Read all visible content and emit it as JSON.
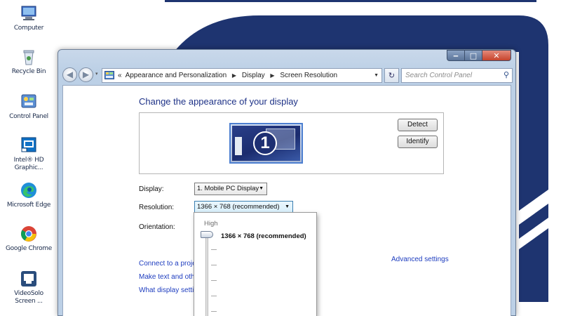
{
  "desktop": {
    "icons": [
      {
        "label": "Computer",
        "icon": "computer-icon"
      },
      {
        "label": "Recycle Bin",
        "icon": "recycle-bin-icon"
      },
      {
        "label": "Control Panel",
        "icon": "control-panel-icon"
      },
      {
        "label": "Intel® HD Graphic...",
        "icon": "intel-graphics-icon"
      },
      {
        "label": "Microsoft Edge",
        "icon": "edge-icon"
      },
      {
        "label": "Google Chrome",
        "icon": "chrome-icon"
      },
      {
        "label": "VideoSolo Screen ...",
        "icon": "videosolo-icon"
      }
    ]
  },
  "window": {
    "buttons": {
      "minimize": "‒",
      "maximize": "□",
      "close": "✕"
    },
    "nav": {
      "back": "◀",
      "forward": "▶",
      "recent": "▾"
    },
    "address": {
      "prefix": "«",
      "crumbs": [
        "Appearance and Personalization",
        "Display",
        "Screen Resolution"
      ],
      "separator": "▶",
      "dropdown": "▼"
    },
    "refresh": "↻",
    "search_placeholder": "Search Control Panel",
    "search_icon": "⚲"
  },
  "main": {
    "heading": "Change the appearance of your display",
    "monitor_number": "1",
    "detect_button": "Detect",
    "identify_button": "Identify",
    "display_label": "Display:",
    "display_value": "1. Mobile PC Display",
    "resolution_label": "Resolution:",
    "resolution_value": "1366 × 768 (recommended)",
    "orientation_label": "Orientation:",
    "combo_arrow": "▼",
    "advanced_link": "Advanced settings",
    "links": [
      "Connect to a projec",
      "Make text and other",
      "What display setting"
    ]
  },
  "resolution_dropdown": {
    "high_label": "High",
    "selected": "1366 × 768 (recommended)",
    "slider_level": 1.0
  },
  "colors": {
    "wallpaper_blue": "#1e3470",
    "link_blue": "#1e3dbf",
    "heading_blue": "#1e3287"
  }
}
